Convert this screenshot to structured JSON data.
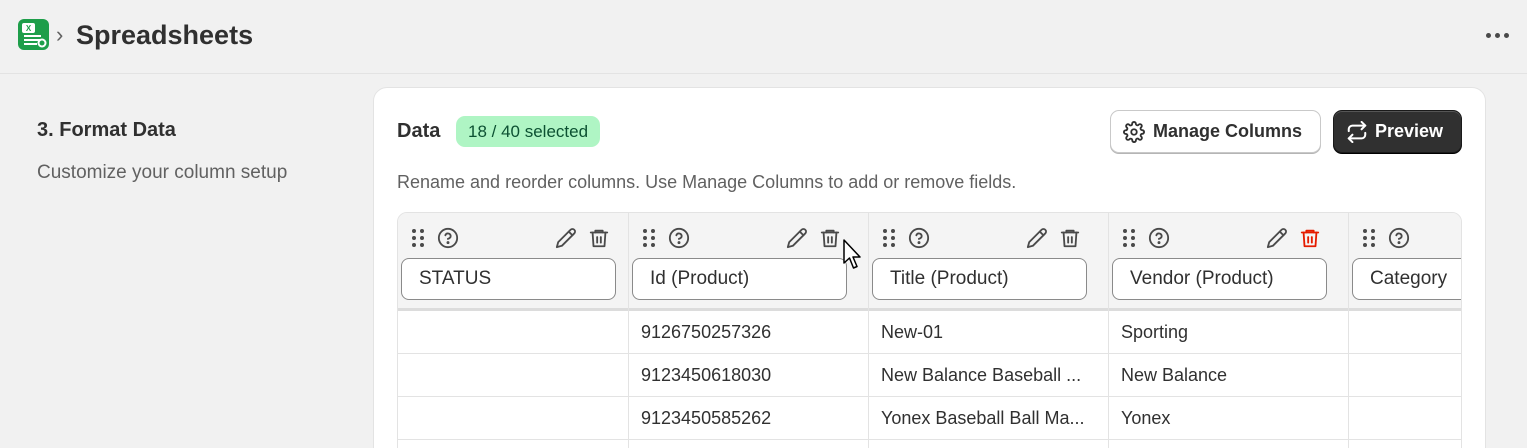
{
  "header": {
    "app_icon": "spreadsheet-app-icon",
    "breadcrumb_separator": "›",
    "title": "Spreadsheets",
    "more_icon": "more-horizontal-icon"
  },
  "section": {
    "title": "3. Format Data",
    "description": "Customize your column setup"
  },
  "card": {
    "heading": "Data",
    "badge": "18 / 40 selected",
    "hint": "Rename and reorder columns. Use Manage Columns to add or remove fields.",
    "manage_label": "Manage Columns",
    "preview_label": "Preview",
    "manage_icon": "gear-icon",
    "preview_icon": "refresh-icon"
  },
  "colors": {
    "badge_bg": "#aff5c4",
    "badge_text": "#0c5132",
    "danger": "#e51c00",
    "preview_bg": "#303030"
  },
  "table": {
    "columns": [
      {
        "name": "STATUS",
        "cells": [
          "",
          "",
          ""
        ]
      },
      {
        "name": "Id (Product)",
        "cells": [
          "9126750257326",
          "9123450618030",
          "9123450585262"
        ]
      },
      {
        "name": "Title (Product)",
        "cells": [
          "New-01",
          "New Balance Baseball ...",
          "Yonex Baseball Ball Ma..."
        ]
      },
      {
        "name": "Vendor (Product)",
        "cells": [
          "Sporting",
          "New Balance",
          "Yonex"
        ]
      },
      {
        "name": "Category",
        "cells": [
          "",
          "",
          ""
        ]
      }
    ]
  }
}
